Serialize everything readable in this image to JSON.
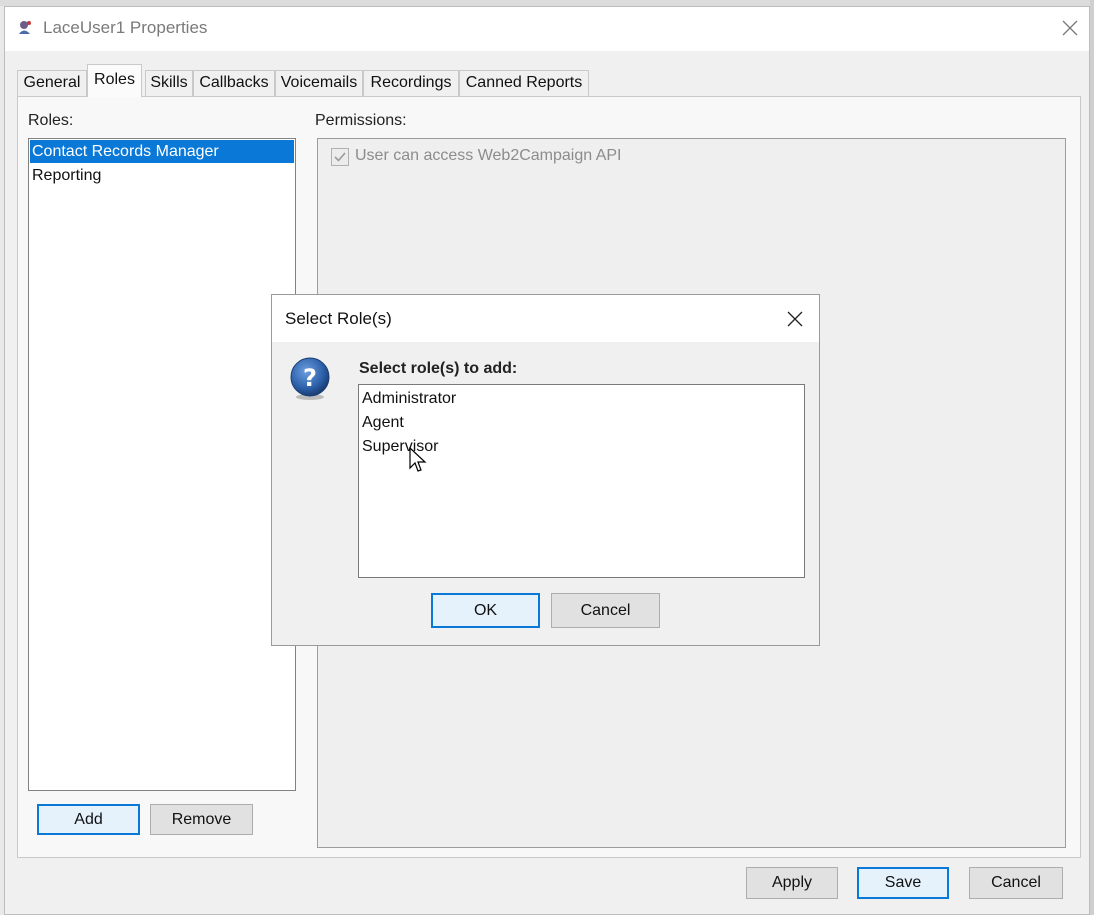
{
  "window": {
    "title": "LaceUser1 Properties",
    "close_icon": "close-icon"
  },
  "tabs": [
    {
      "label": "General",
      "active": false
    },
    {
      "label": "Roles",
      "active": true
    },
    {
      "label": "Skills",
      "active": false
    },
    {
      "label": "Callbacks",
      "active": false
    },
    {
      "label": "Voicemails",
      "active": false
    },
    {
      "label": "Recordings",
      "active": false
    },
    {
      "label": "Canned Reports",
      "active": false
    }
  ],
  "roles": {
    "label": "Roles:",
    "items": [
      {
        "label": "Contact Records Manager",
        "selected": true
      },
      {
        "label": "Reporting",
        "selected": false
      }
    ],
    "add_label": "Add",
    "remove_label": "Remove"
  },
  "permissions": {
    "label": "Permissions:",
    "items": [
      {
        "label": "User can access Web2Campaign API",
        "checked": true,
        "enabled": false
      }
    ]
  },
  "footer": {
    "apply_label": "Apply",
    "save_label": "Save",
    "cancel_label": "Cancel"
  },
  "dialog": {
    "title": "Select Role(s)",
    "icon": "question-icon",
    "prompt": "Select role(s) to add:",
    "options": [
      "Administrator",
      "Agent",
      "Supervisor"
    ],
    "ok_label": "OK",
    "cancel_label": "Cancel"
  },
  "colors": {
    "selection": "#0a78d7",
    "question_icon": "#2b5fa8"
  }
}
